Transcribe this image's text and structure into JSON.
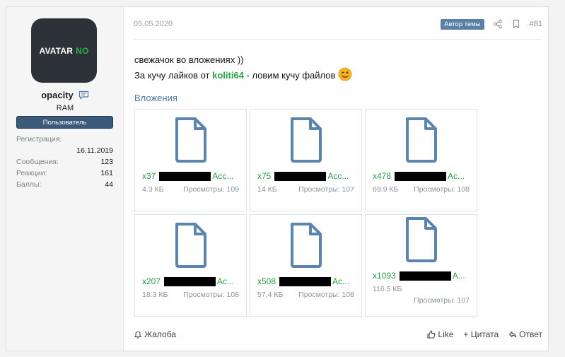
{
  "user": {
    "avatar_text": "AVATAR",
    "avatar_text_accent": "NO",
    "name": "opacity",
    "title": "RAM",
    "role": "Пользователь",
    "stats": {
      "reg_label": "Регистрация:",
      "reg_value": "16.11.2019",
      "messages_label": "Сообщения:",
      "messages_value": "123",
      "reactions_label": "Реакции:",
      "reactions_value": "161",
      "points_label": "Баллы:",
      "points_value": "44"
    }
  },
  "post": {
    "date": "05.05.2020",
    "author_badge": "Автор темы",
    "number": "#81",
    "line1": "свежачок во вложениях ))",
    "line2_before": "За кучу лайков от ",
    "line2_user": "koliti64",
    "line2_after": " - ловим кучу файлов",
    "attachments_title": "Вложения",
    "attachments": [
      {
        "prefix": "x37",
        "suffix": "Acc...",
        "size": "4.3 КБ",
        "views": "Просмотры: 109"
      },
      {
        "prefix": "x75",
        "suffix": "Acc...",
        "size": "14 КБ",
        "views": "Просмотры: 107"
      },
      {
        "prefix": "x478",
        "suffix": "Ac...",
        "size": "69.9 КБ",
        "views": "Просмотры: 108"
      },
      {
        "prefix": "x207",
        "suffix": "Ac...",
        "size": "18.3 КБ",
        "views": "Просмотры: 108"
      },
      {
        "prefix": "x508",
        "suffix": "Ac...",
        "size": "57.4 КБ",
        "views": "Просмотры: 108"
      },
      {
        "prefix": "x1093",
        "suffix": "A...",
        "size": "116.5 КБ",
        "views": "Просмотры: 107"
      }
    ],
    "actions": {
      "report": "Жалоба",
      "like": "Like",
      "quote": "+ Цитата",
      "reply": "Ответ"
    }
  },
  "icons": {
    "header": [
      "share-icon",
      "bookmark-icon"
    ],
    "file": "file-icon",
    "message": "message-icon",
    "emoji": "wink-emoji-icon"
  },
  "colors": {
    "link_green": "#2d9d4a",
    "accent_blue": "#4d7aa6",
    "role_bg": "#3b5a7a",
    "badge_bg": "#5b7fa6"
  }
}
